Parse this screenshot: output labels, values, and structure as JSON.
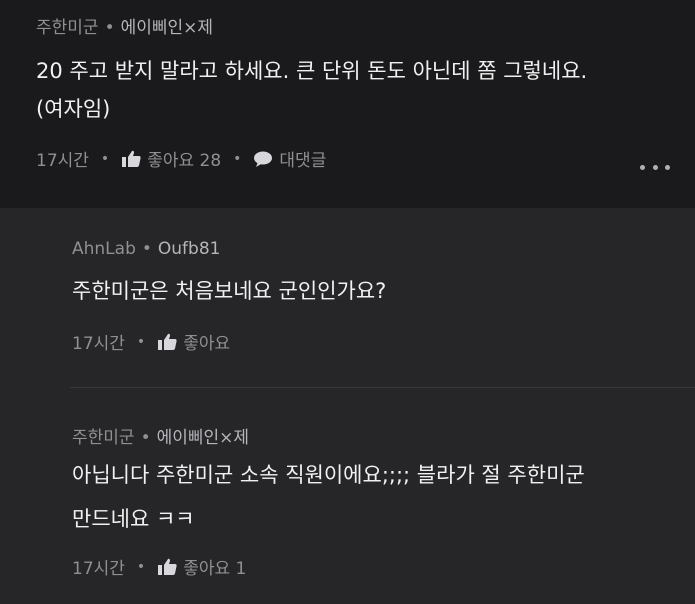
{
  "main_comment": {
    "company": "주한미군",
    "nickname": "에이삐인×제",
    "text_line1": "20 주고 받지 말라고 하세요. 큰 단위 돈도 아닌데 쫌 그렇네요.",
    "text_line2": "(여자임)",
    "time": "17시간",
    "like_label": "좋아요 28",
    "reply_label": "대댓글"
  },
  "replies": [
    {
      "company": "AhnLab",
      "nickname": "Oufb81",
      "text_line1": "주한미군은 처음보네요 군인인가요?",
      "time": "17시간",
      "like_label": "좋아요"
    },
    {
      "company": "주한미군",
      "nickname": "에이삐인×제",
      "text_line1": "아닙니다 주한미군 소속 직원이에요;;;; 블라가 절 주한미군",
      "text_line2": "만드네요 ㅋㅋ",
      "time": "17시간",
      "like_label": "좋아요 1"
    }
  ],
  "icons": {
    "like": "thumbs-up-icon",
    "reply": "speech-bubble-icon",
    "more": "more-dots-icon"
  },
  "colors": {
    "background": "#1a1a1c",
    "reply_background": "#262628",
    "text": "#f1f1f1",
    "muted": "#8f8f94"
  }
}
